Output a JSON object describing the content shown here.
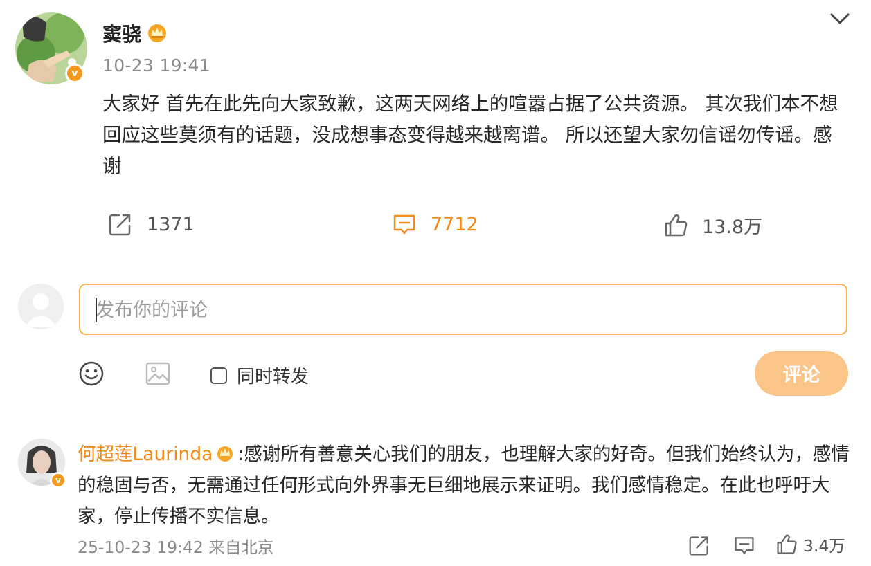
{
  "post": {
    "author": "窦骁",
    "time": "10-23 19:41",
    "verified_mark": "v",
    "text": "大家好 首先在此先向大家致歉，这两天网络上的喧嚣占据了公共资源。 其次我们本不想回应这些莫须有的话题，没成想事态变得越来越离谱。 所以还望大家勿信谣勿传谣。感谢",
    "reposts": "1371",
    "comments": "7712",
    "likes": "13.8万",
    "icons": [
      "crown-badge-icon",
      "chevron-down-icon",
      "repost-icon",
      "comment-icon",
      "like-icon"
    ]
  },
  "comment_box": {
    "placeholder": "发布你的评论",
    "repost_label": "同时转发",
    "submit_label": "评论",
    "icons": [
      "emoji-icon",
      "image-icon"
    ]
  },
  "reply": {
    "user": "何超莲Laurinda",
    "separator": ":",
    "text": "感谢所有善意关心我们的朋友，也理解大家的好奇。但我们始终认为，感情的稳固与否，无需通过任何形式向外界事无巨细地展示来证明。我们感情稳定。在此也呼吁大家，停止传播不实信息。",
    "meta": "25-10-23 19:42 来自北京",
    "likes": "3.4万"
  },
  "colors": {
    "accent": "#f08a19",
    "input_border": "#f1b454",
    "submit_bg": "#fbc58a",
    "muted": "#8a8a8a"
  }
}
